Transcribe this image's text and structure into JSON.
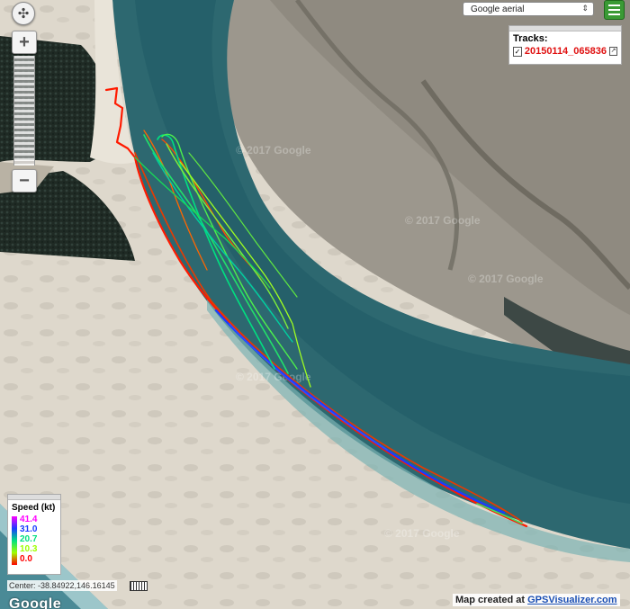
{
  "map": {
    "type_select": "Google aerial",
    "tracks_title": "Tracks:",
    "track_checked": "✓",
    "track_name": "20150114_065836",
    "legend": {
      "title": "Speed (kt)",
      "values": [
        "41.4",
        "31.0",
        "20.7",
        "10.3",
        "0.0"
      ],
      "colors": [
        "#ff00ff",
        "#1a3cff",
        "#00e080",
        "#a0ff00",
        "#ff0000"
      ]
    },
    "center": "Center: -38.84922,146.16145",
    "credit_prefix": "Map created at ",
    "credit_link": "GPSVisualizer.com",
    "google_logo": "Google",
    "watermark": "© 2017 Google",
    "icons": {
      "compass": "compass-icon",
      "zoom_in": "+",
      "zoom_out": "−",
      "menu": "hamburger-icon",
      "ruler": "ruler-icon"
    }
  }
}
